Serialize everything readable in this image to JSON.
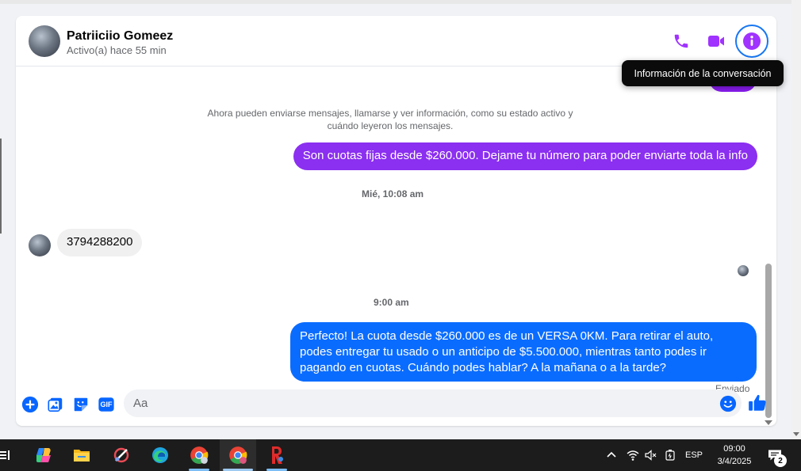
{
  "header": {
    "contact_name": "Patriiciio Gomeez",
    "contact_status": "Activo(a) hace 55 min"
  },
  "tooltip": "Información de la conversación",
  "messages": {
    "system_note": "Ahora pueden enviarse mensajes, llamarse y ver información, como su estado activo y cuándo leyeron los mensajes.",
    "outgoing_1": "Son cuotas fijas desde $260.000. Dejame tu número para poder enviarte toda la info",
    "timestamp_1": "Mié, 10:08 am",
    "incoming_1": "3794288200",
    "timestamp_2": "9:00 am",
    "outgoing_2": "Perfecto! La cuota desde $260.000 es de un VERSA 0KM. Para retirar el auto, podes entregar tu usado o un anticipo de $5.500.000, mientras tanto podes ir pagando en cuotas. Cuándo podes hablar? A la mañana o a la tarde?",
    "sent_status": "Enviado"
  },
  "composer": {
    "placeholder": "Aa",
    "gif_label": "GIF"
  },
  "taskbar": {
    "language": "ESP",
    "time": "09:00",
    "date": "3/4/2025",
    "notification_count": "2"
  },
  "colors": {
    "accent_purple": "#a033ff",
    "outgoing_purple": "#8b2ff0",
    "outgoing_blue": "#0a6cff",
    "composer_blue": "#0866ff"
  }
}
